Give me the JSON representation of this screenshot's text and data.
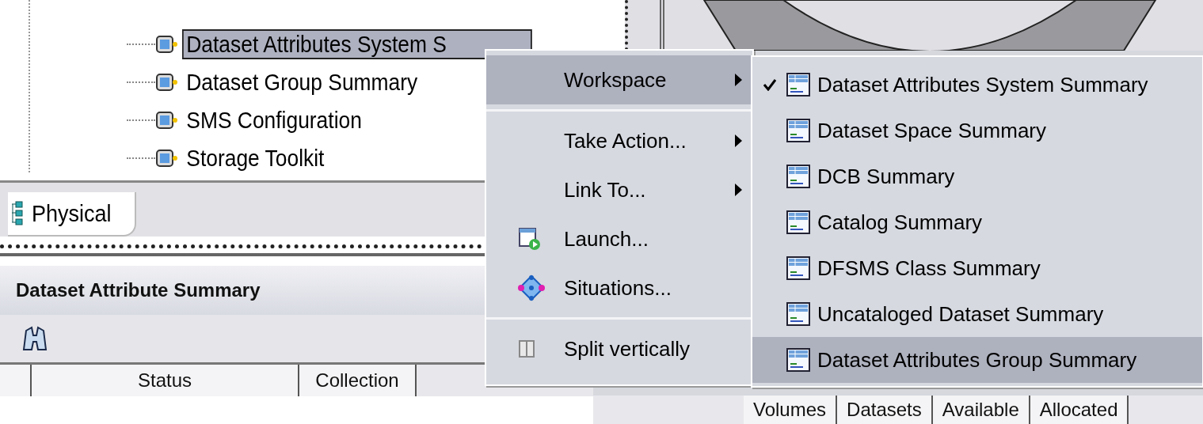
{
  "tree": {
    "items": [
      {
        "label": "Dataset Attributes System S",
        "selected": true
      },
      {
        "label": "Dataset Group Summary",
        "selected": false
      },
      {
        "label": "SMS Configuration",
        "selected": false
      },
      {
        "label": "Storage Toolkit",
        "selected": false
      }
    ]
  },
  "tabs": [
    {
      "label": "Physical",
      "selected": true
    }
  ],
  "panel": {
    "title": "Dataset Attribute Summary"
  },
  "table": {
    "columns_left": [
      "Status",
      "Collection"
    ],
    "columns_right": [
      "Volumes",
      "Datasets",
      "Available",
      "Allocated"
    ]
  },
  "context_menu": {
    "groups": [
      [
        {
          "label": "Workspace",
          "kind": "submenu",
          "selected": true
        }
      ],
      [
        {
          "label": "Take Action...",
          "kind": "submenu",
          "selected": false
        },
        {
          "label": "Link To...",
          "kind": "submenu",
          "selected": false
        },
        {
          "label": "Launch...",
          "kind": "launch",
          "selected": false
        },
        {
          "label": "Situations...",
          "kind": "situations",
          "selected": false
        }
      ],
      [
        {
          "label": "Split vertically",
          "kind": "split",
          "selected": false
        }
      ]
    ]
  },
  "submenu": {
    "items": [
      {
        "label": "Dataset Attributes System Summary",
        "checked": true,
        "selected": false
      },
      {
        "label": "Dataset Space Summary",
        "checked": false,
        "selected": false
      },
      {
        "label": "DCB Summary",
        "checked": false,
        "selected": false
      },
      {
        "label": "Catalog Summary",
        "checked": false,
        "selected": false
      },
      {
        "label": "DFSMS Class Summary",
        "checked": false,
        "selected": false
      },
      {
        "label": "Uncataloged Dataset Summary",
        "checked": false,
        "selected": false
      },
      {
        "label": "Dataset Attributes Group Summary",
        "checked": false,
        "selected": true
      }
    ]
  }
}
